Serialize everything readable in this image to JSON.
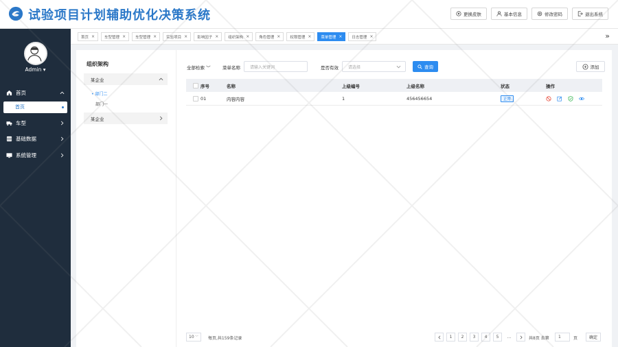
{
  "header": {
    "title": "试验项目计划辅助优化决策系统",
    "buttons": [
      {
        "icon": "skin-icon",
        "label": "更换皮肤"
      },
      {
        "icon": "user-icon",
        "label": "基本信息"
      },
      {
        "icon": "settings-icon",
        "label": "修改密码"
      },
      {
        "icon": "logout-icon",
        "label": "退出系统"
      }
    ]
  },
  "sidebar": {
    "user": "Admin",
    "items": [
      {
        "icon": "home-icon",
        "label": "首页",
        "expanded": true
      },
      {
        "label": "首页",
        "sub": true
      },
      {
        "icon": "truck-icon",
        "label": "车型"
      },
      {
        "icon": "database-icon",
        "label": "基础数据"
      },
      {
        "icon": "monitor-icon",
        "label": "系统管理"
      }
    ]
  },
  "tabs": [
    {
      "label": "首页",
      "active": false
    },
    {
      "label": "车型管理",
      "active": false
    },
    {
      "label": "车型管理",
      "active": false
    },
    {
      "label": "实验项目",
      "active": false
    },
    {
      "label": "影响因子",
      "active": false
    },
    {
      "label": "组织架构",
      "active": false
    },
    {
      "label": "角色管理",
      "active": false
    },
    {
      "label": "权限管理",
      "active": false
    },
    {
      "label": "菜单管理",
      "active": true
    },
    {
      "label": "日志管理",
      "active": false
    }
  ],
  "tree": {
    "title": "组织架构",
    "groups": [
      {
        "label": "某企业",
        "expanded": true,
        "children": [
          {
            "label": "部门二",
            "active": true
          },
          {
            "label": "部门一",
            "active": false
          }
        ]
      },
      {
        "label": "某企业",
        "expanded": false,
        "children": []
      }
    ]
  },
  "filters": {
    "all_search": "全部检索",
    "menu_name_label": "菜单名称",
    "menu_name_placeholder": "请输入关键词",
    "valid_label": "是否有效",
    "valid_placeholder": "请选择",
    "query_button": "查询",
    "add_button": "添加"
  },
  "table": {
    "columns": [
      "序号",
      "名称",
      "上级编号",
      "上级名称",
      "状态",
      "操作"
    ],
    "rows": [
      {
        "index": "01",
        "name": "内容内容",
        "parent_id": "1",
        "parent_name": "456456654",
        "status": "正常"
      }
    ]
  },
  "footer": {
    "page_size": "10",
    "total_text": "每页,共159条记录",
    "pages": [
      "1",
      "2",
      "3",
      "4",
      "5"
    ],
    "ellipsis": "...",
    "total_pages_text": "共8页 去第",
    "goto_value": "1",
    "goto_unit": "页",
    "confirm": "确定"
  },
  "colors": {
    "brand": "#2b78c8",
    "accent": "#2d8cf0",
    "sidebar": "#1f2d3d"
  }
}
